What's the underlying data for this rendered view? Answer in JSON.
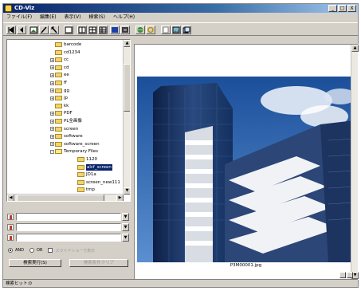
{
  "window": {
    "title": "CD-Viz",
    "buttons": {
      "minimize": "_",
      "maximize": "□",
      "close": "X"
    }
  },
  "menu": [
    "ファイル(F)",
    "編集(E)",
    "表示(V)",
    "検索(S)",
    "ヘルプ(H)"
  ],
  "toolbar": {
    "icons": [
      "first-icon",
      "prev-icon",
      "image-icon",
      "draw-icon",
      "select-icon",
      "rect-icon",
      "view-single-icon",
      "view-grid-icon",
      "view-detail-icon",
      "blue-icon",
      "stop-icon",
      "globe-icon",
      "refresh-icon",
      "page-icon",
      "picture-icon",
      "multi-icon"
    ]
  },
  "tree": {
    "items": [
      {
        "label": "barcode",
        "expander": ""
      },
      {
        "label": "cd1234",
        "expander": ""
      },
      {
        "label": "cc",
        "expander": "+"
      },
      {
        "label": "cd",
        "expander": "+"
      },
      {
        "label": "ee",
        "expander": "+"
      },
      {
        "label": "ff",
        "expander": "+"
      },
      {
        "label": "gg",
        "expander": "+"
      },
      {
        "label": "jp",
        "expander": "+"
      },
      {
        "label": "kk",
        "expander": ""
      },
      {
        "label": "PDF",
        "expander": "+"
      },
      {
        "label": "PL全画像",
        "expander": "+"
      },
      {
        "label": "screen",
        "expander": "+"
      },
      {
        "label": "software",
        "expander": "+"
      },
      {
        "label": "software_screen",
        "expander": "+"
      },
      {
        "label": "Temporary Files",
        "expander": "-"
      },
      {
        "label": "1120",
        "expander": ""
      },
      {
        "label": "alcf_screen",
        "expander": "",
        "selected": true
      },
      {
        "label": "JD1a",
        "expander": ""
      },
      {
        "label": "screen_new111",
        "expander": ""
      },
      {
        "label": "tmp",
        "expander": ""
      }
    ]
  },
  "search": {
    "fields": [
      {
        "value": ""
      },
      {
        "value": ""
      },
      {
        "value": ""
      }
    ],
    "options": {
      "and_label": "AND",
      "or_label": "OR",
      "extra_label": "スライドショーで表示"
    },
    "search_button": "検索実行(S)",
    "clear_button": "検索条件クリア"
  },
  "preview": {
    "filename": "P3M00001.jpg"
  },
  "status": {
    "text": "検索ヒット:0"
  }
}
